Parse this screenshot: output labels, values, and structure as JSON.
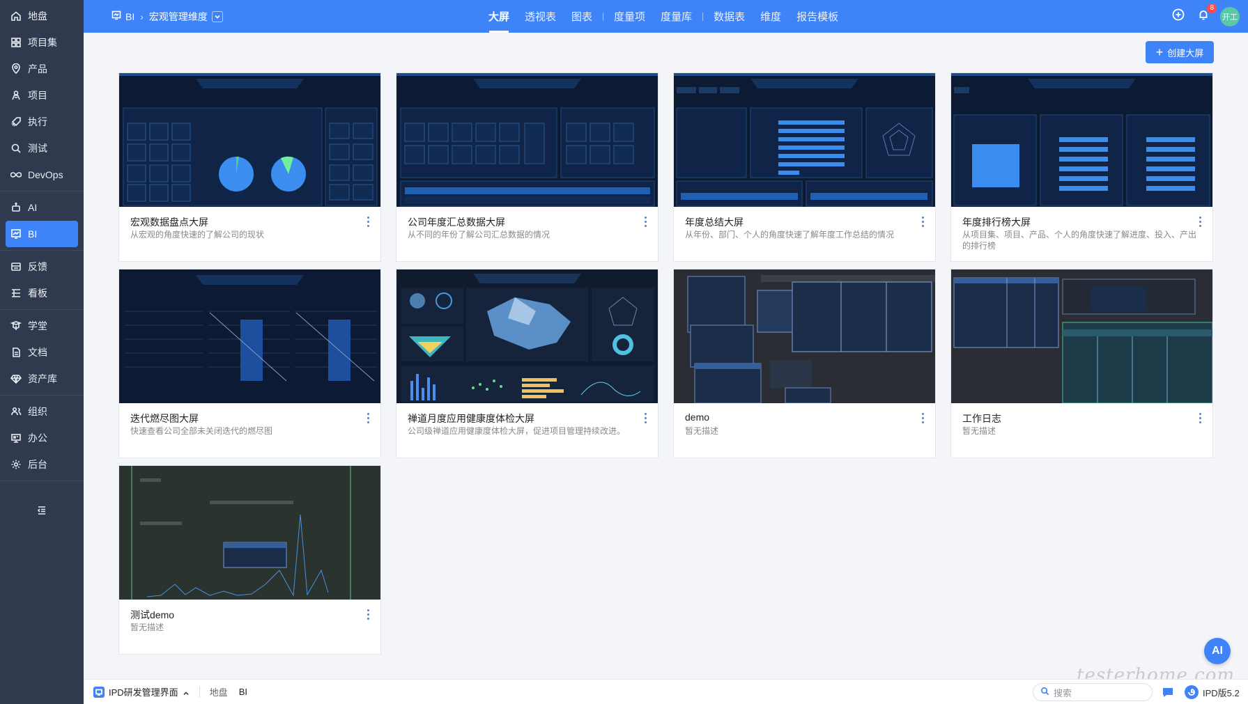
{
  "sidebar": {
    "groups": [
      [
        {
          "label": "地盘",
          "icon": "home-icon"
        },
        {
          "label": "项目集",
          "icon": "grid-icon"
        },
        {
          "label": "产品",
          "icon": "location-icon"
        },
        {
          "label": "项目",
          "icon": "person-icon"
        },
        {
          "label": "执行",
          "icon": "rocket-icon"
        },
        {
          "label": "测试",
          "icon": "search-icon"
        },
        {
          "label": "DevOps",
          "icon": "infinity-icon"
        }
      ],
      [
        {
          "label": "AI",
          "icon": "robot-icon"
        },
        {
          "label": "BI",
          "icon": "chart-icon",
          "active": true
        }
      ],
      [
        {
          "label": "反馈",
          "icon": "feedback-icon"
        },
        {
          "label": "看板",
          "icon": "board-icon"
        }
      ],
      [
        {
          "label": "学堂",
          "icon": "school-icon"
        },
        {
          "label": "文档",
          "icon": "doc-icon"
        },
        {
          "label": "资产库",
          "icon": "diamond-icon"
        }
      ],
      [
        {
          "label": "组织",
          "icon": "team-icon"
        },
        {
          "label": "办公",
          "icon": "office-icon"
        },
        {
          "label": "后台",
          "icon": "gear-icon"
        }
      ]
    ]
  },
  "header": {
    "crumb_root": "BI",
    "crumb_current": "宏观管理维度",
    "tabs": [
      "大屏",
      "透视表",
      "图表",
      "度量项",
      "度量库",
      "数据表",
      "维度",
      "报告模板"
    ],
    "notification_count": "8",
    "avatar_text": "开工"
  },
  "toolbar": {
    "create_label": "创建大屏"
  },
  "cards": [
    {
      "title": "宏观数据盘点大屏",
      "desc": "从宏观的角度快速的了解公司的现状",
      "theme": "dark-blue"
    },
    {
      "title": "公司年度汇总数据大屏",
      "desc": "从不同的年份了解公司汇总数据的情况",
      "theme": "dark-blue"
    },
    {
      "title": "年度总结大屏",
      "desc": "从年份、部门、个人的角度快速了解年度工作总结的情况",
      "theme": "dark-blue"
    },
    {
      "title": "年度排行榜大屏",
      "desc": "从项目集、项目、产品、个人的角度快速了解进度、投入、产出的排行榜",
      "theme": "dark-blue"
    },
    {
      "title": "迭代燃尽图大屏",
      "desc": "快速查看公司全部未关闭迭代的燃尽图",
      "theme": "dark-blue"
    },
    {
      "title": "禅道月度应用健康度体检大屏",
      "desc": "公司级禅道应用健康度体检大屏，促进项目管理持续改进。",
      "theme": "dark-blue"
    },
    {
      "title": "demo",
      "desc": "暂无描述",
      "theme": "dark-gray"
    },
    {
      "title": "工作日志",
      "desc": "暂无描述",
      "theme": "dark-gray"
    },
    {
      "title": "测试demo",
      "desc": "暂无描述",
      "theme": "dark-green"
    }
  ],
  "bottombar": {
    "app_name": "IPD研发管理界面",
    "links": [
      "地盘",
      "BI"
    ],
    "search_placeholder": "搜索",
    "version": "IPD版5.2"
  },
  "fab": {
    "label": "AI"
  },
  "watermark": "testerhome.com",
  "colors": {
    "primary": "#3f83f8",
    "sidebar_bg": "#2f3a4f",
    "thumb_dark": "#0d1a33"
  }
}
